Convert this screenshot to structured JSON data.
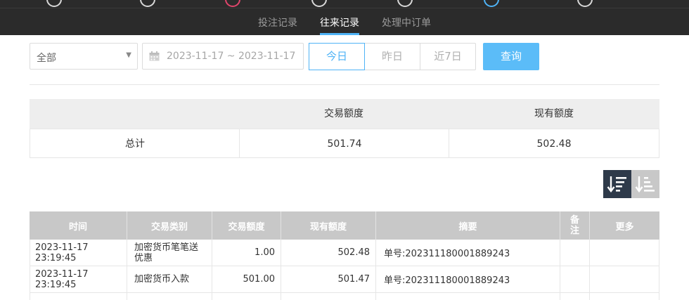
{
  "nav": {
    "tabs": [
      {
        "label": "投注记录"
      },
      {
        "label": "往来记录"
      },
      {
        "label": "处理中订单"
      }
    ]
  },
  "filters": {
    "type_select": "全部",
    "date_range": "2023-11-17 ~ 2023-11-17",
    "quick_today": "今日",
    "quick_yesterday": "昨日",
    "quick_7days": "近7日",
    "query_label": "查询"
  },
  "summary": {
    "headers": [
      "",
      "交易额度",
      "现有额度"
    ],
    "row_label": "总计",
    "trade_amount": "501.74",
    "current_amount": "502.48"
  },
  "table": {
    "headers": [
      "时间",
      "交易类别",
      "交易额度",
      "现有额度",
      "摘要",
      "备注",
      "更多"
    ],
    "rows": [
      {
        "time": "2023-11-17 23:19:45",
        "type": "加密货币笔笔送优惠",
        "amount": "1.00",
        "balance": "502.48",
        "summary": "单号:202311180001889243",
        "note": "",
        "more": ""
      },
      {
        "time": "2023-11-17 23:19:45",
        "type": "加密货币入款",
        "amount": "501.00",
        "balance": "501.47",
        "summary": "单号:202311180001889243",
        "note": "",
        "more": ""
      }
    ]
  },
  "colors": {
    "accent": "#4fb3f6",
    "query_button": "#5bbcf8",
    "topbar": "#2b2b2b",
    "table_header": "#c8c8c8"
  },
  "icons": {
    "select_arrow": "triangle-down-icon",
    "date": "calendar-icon",
    "sort_desc": "sort-descending-icon",
    "sort_asc": "sort-ascending-icon"
  }
}
